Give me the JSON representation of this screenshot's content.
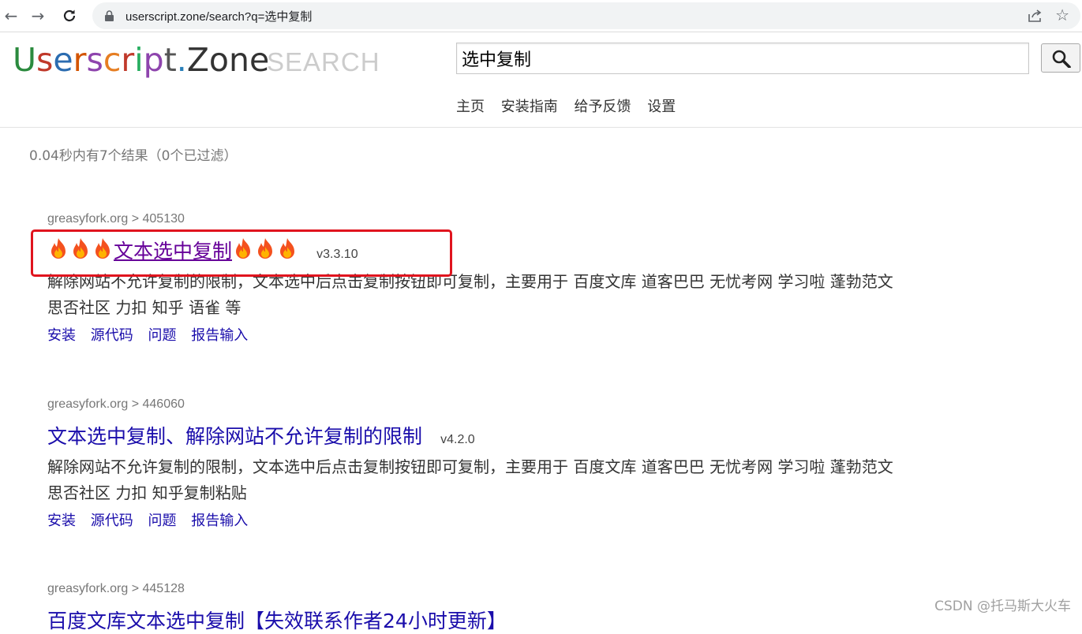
{
  "browser": {
    "url": "userscript.zone/search?q=选中复制"
  },
  "header": {
    "logo_letters": [
      {
        "ch": "U",
        "color": "#2b8a3e"
      },
      {
        "ch": "s",
        "color": "#c0392b"
      },
      {
        "ch": "e",
        "color": "#2b6cb0"
      },
      {
        "ch": "r",
        "color": "#d35400"
      },
      {
        "ch": "s",
        "color": "#8e44ad"
      },
      {
        "ch": "c",
        "color": "#e67e22"
      },
      {
        "ch": "r",
        "color": "#c0392b"
      },
      {
        "ch": "i",
        "color": "#27ae60"
      },
      {
        "ch": "p",
        "color": "#8e44ad"
      },
      {
        "ch": "t",
        "color": "#555555"
      },
      {
        "ch": ".",
        "color": "#2980b9"
      },
      {
        "ch": "Zone",
        "color": "#333333"
      }
    ],
    "search_word": "SEARCH",
    "search_value": "选中复制",
    "nav": [
      "主页",
      "安装指南",
      "给予反馈",
      "设置"
    ]
  },
  "stats": "0.04秒内有7个结果（0个已过滤）",
  "results": [
    {
      "crumb": "greasyfork.org > 405130",
      "title": "文本选中复制",
      "version": "v3.3.10",
      "desc": "解除网站不允许复制的限制，文本选中后点击复制按钮即可复制，主要用于 百度文库 道客巴巴 无忧考网 学习啦 蓬勃范文 思否社区 力扣 知乎 语雀 等",
      "links": [
        "安装",
        "源代码",
        "问题",
        "报告输入"
      ]
    },
    {
      "crumb": "greasyfork.org > 446060",
      "title": "文本选中复制、解除网站不允许复制的限制",
      "version": "v4.2.0",
      "desc": "解除网站不允许复制的限制，文本选中后点击复制按钮即可复制，主要用于 百度文库 道客巴巴 无忧考网 学习啦 蓬勃范文 思否社区 力扣 知乎复制粘贴",
      "links": [
        "安装",
        "源代码",
        "问题",
        "报告输入"
      ]
    },
    {
      "crumb": "greasyfork.org > 445128",
      "title": "百度文库文本选中复制【失效联系作者24小时更新】"
    }
  ],
  "colors": {
    "link": "#1a0dab",
    "visited": "#660099",
    "highlight": "#e0141e"
  },
  "watermark": "CSDN @托马斯大火车"
}
